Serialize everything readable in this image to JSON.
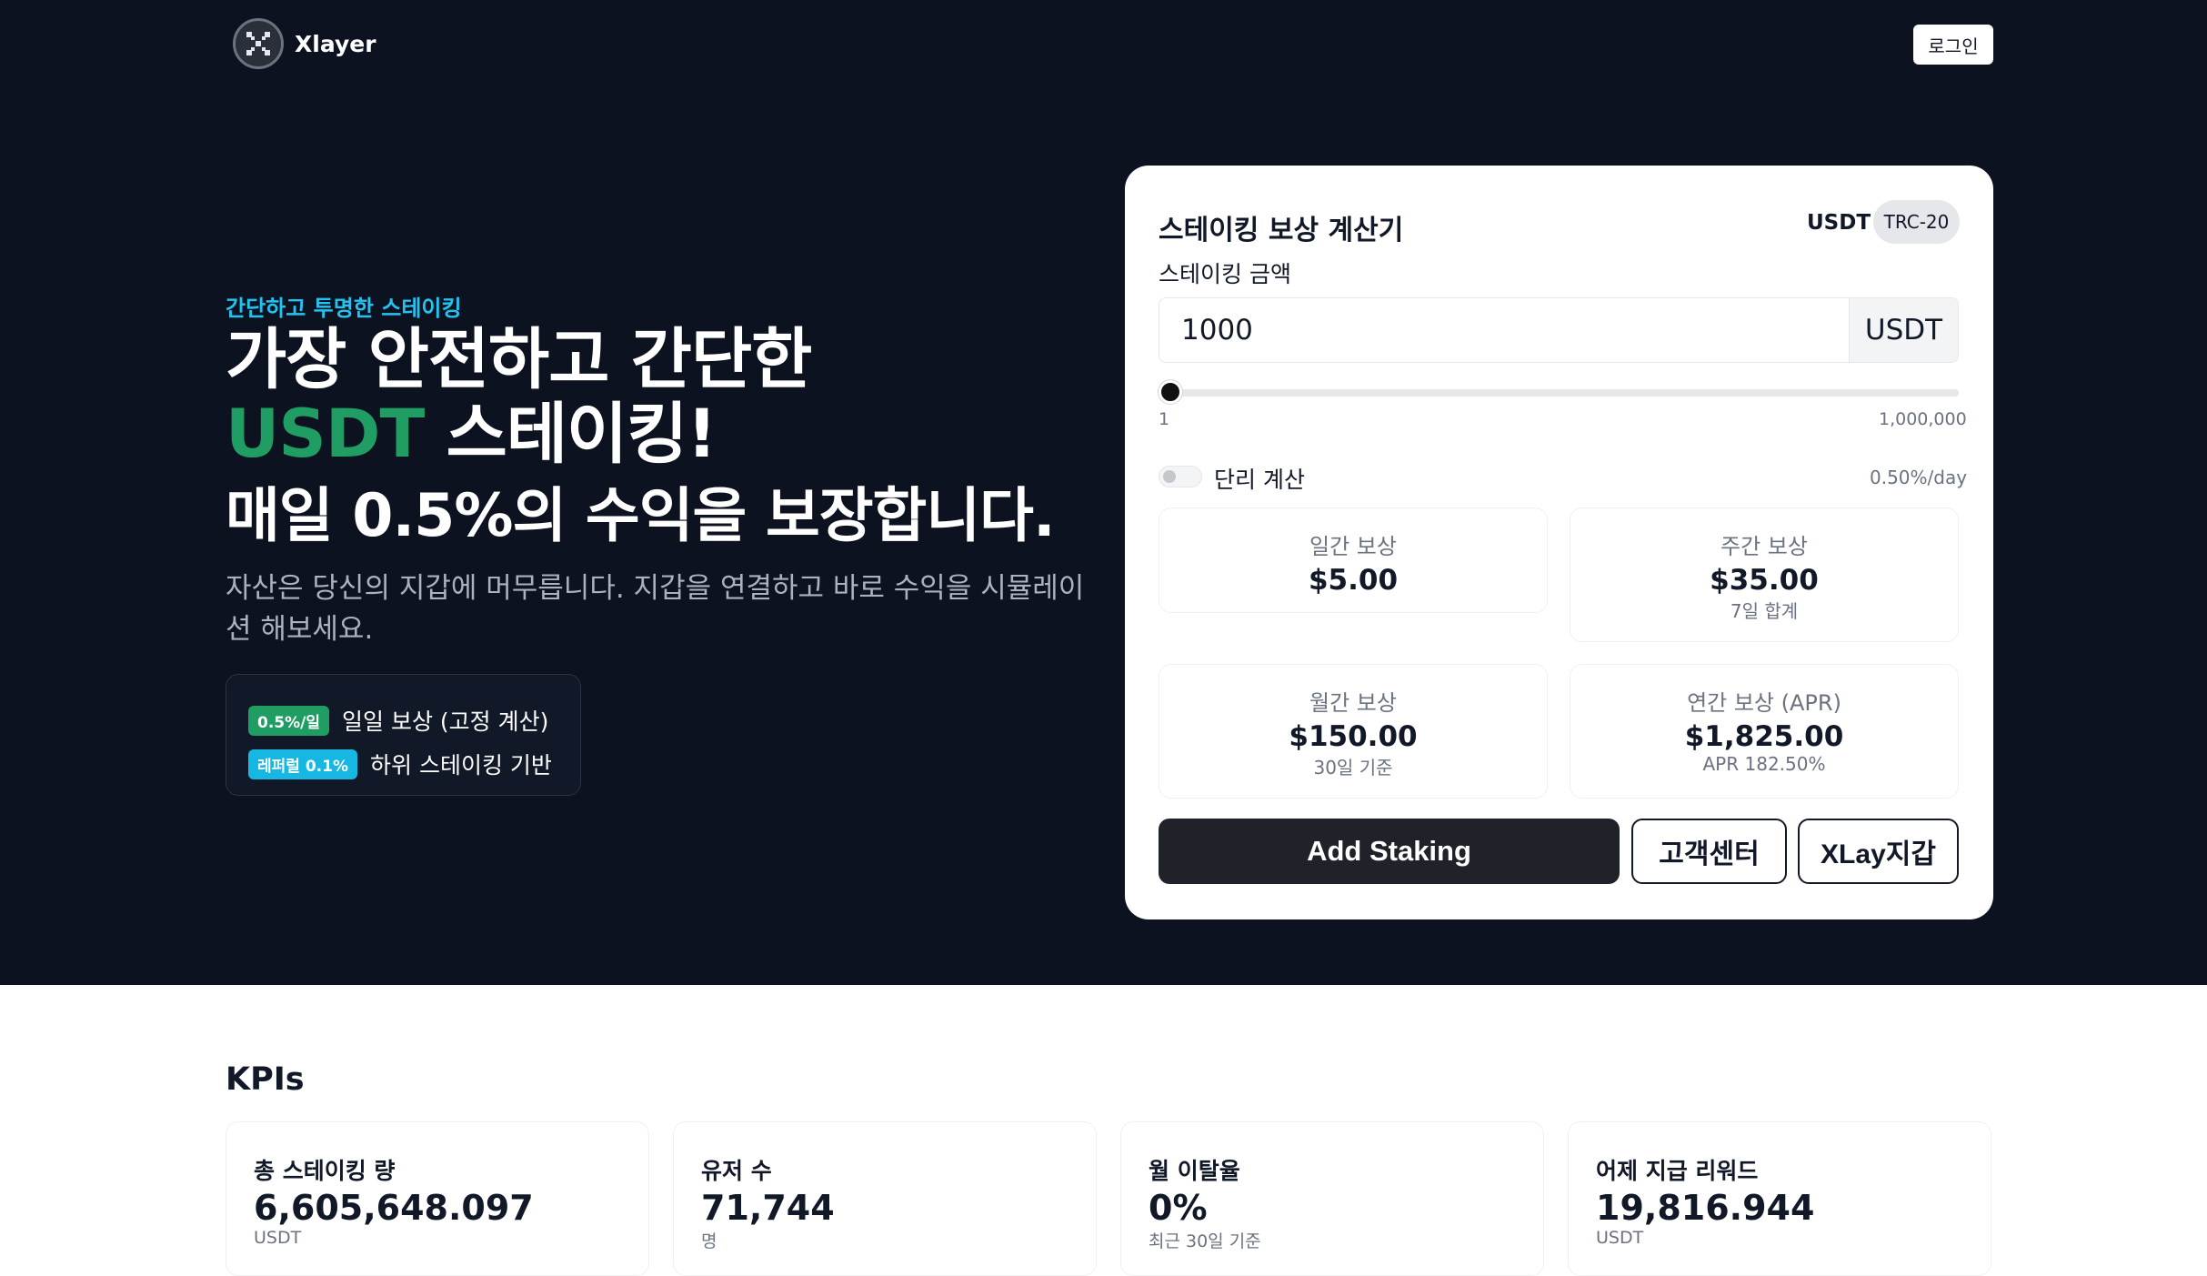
{
  "header": {
    "logo_text": "Xlayer",
    "login_label": "로그인"
  },
  "hero": {
    "eyebrow": "간단하고 투명한 스테이킹",
    "headline_line1": "가장 안전하고 간단한",
    "headline_accent": "USDT",
    "headline_line2_rest": " 스테이킹!",
    "subline": "매일 0.5%의 수익을 보장합니다.",
    "description": "자산은 당신의 지갑에 머무릅니다. 지갑을 연결하고 바로 수익을 시뮬레이션 해보세요.",
    "info": [
      {
        "badge": "0.5%/일",
        "text": "일일 보상 (고정 계산)"
      },
      {
        "badge": "레퍼럴 0.1%",
        "text": "하위 스테이킹 기반"
      }
    ]
  },
  "calculator": {
    "title": "스테이킹 보상 계산기",
    "currency": "USDT",
    "network": "TRC-20",
    "amount_label": "스테이킹 금액",
    "amount_value": "1000",
    "amount_unit": "USDT",
    "range_min": "1",
    "range_max": "1,000,000",
    "slider_value": 1000,
    "toggle_label": "단리 계산",
    "toggle_on": false,
    "rate": "0.50%/day",
    "stats": [
      {
        "label": "일간 보상",
        "value": "$5.00",
        "sub": ""
      },
      {
        "label": "주간 보상",
        "value": "$35.00",
        "sub": "7일 합계"
      },
      {
        "label": "월간 보상",
        "value": "$150.00",
        "sub": "30일 기준"
      },
      {
        "label": "연간 보상 (APR)",
        "value": "$1,825.00",
        "sub": "APR 182.50%"
      }
    ],
    "add_label": "Add Staking",
    "support_label": "고객센터",
    "wallet_label": "XLay지갑"
  },
  "kpis": {
    "heading": "KPIs",
    "items": [
      {
        "label": "총 스테이킹 량",
        "value": "6,605,648.097",
        "unit": "USDT"
      },
      {
        "label": "유저 수",
        "value": "71,744",
        "unit": "명"
      },
      {
        "label": "월 이탈율",
        "value": "0%",
        "unit": "최근 30일 기준"
      },
      {
        "label": "어제 지급 리워드",
        "value": "19,816.944",
        "unit": "USDT"
      }
    ]
  }
}
